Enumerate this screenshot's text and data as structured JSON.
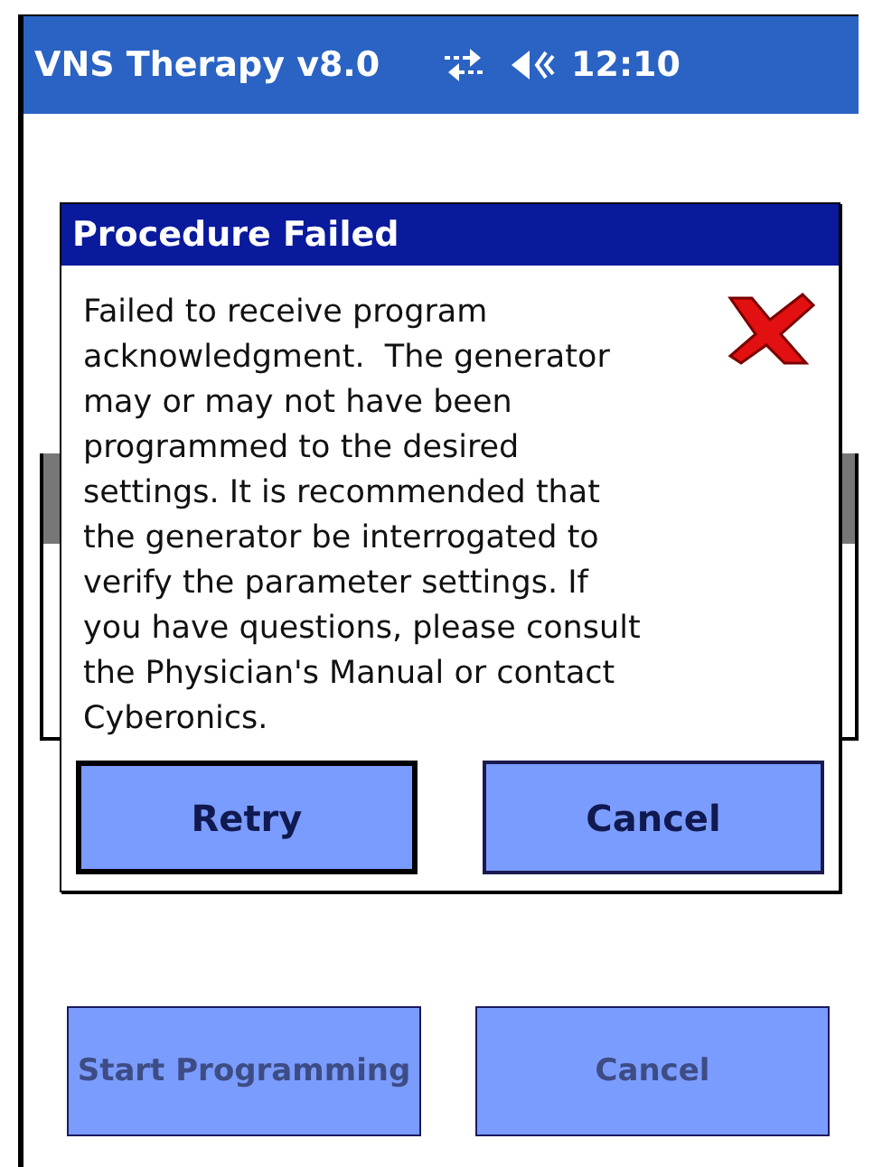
{
  "status_bar": {
    "title": "VNS Therapy v8.0",
    "time": "12:10"
  },
  "background_buttons": [
    {
      "label": "Start Programming",
      "disabled": true
    },
    {
      "label": "Cancel",
      "disabled": true
    }
  ],
  "dialog": {
    "title": "Procedure Failed",
    "message": "Failed to receive program acknowledgment.  The generator may or may not have been programmed to the desired settings. It is recommended that the generator be interrogated to verify the parameter settings. If you have questions, please consult the Physician's Manual or contact Cyberonics.",
    "buttons": [
      {
        "label": "Retry",
        "focused": true
      },
      {
        "label": "Cancel",
        "focused": false
      }
    ]
  }
}
